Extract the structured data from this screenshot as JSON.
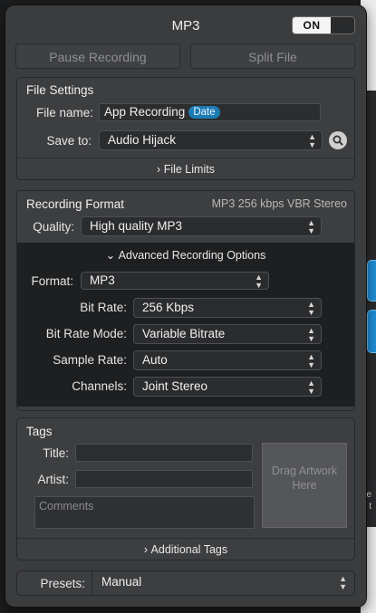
{
  "window": {
    "title": "MP3",
    "toggle_label": "ON"
  },
  "toolbar": {
    "pause_label": "Pause Recording",
    "split_label": "Split File"
  },
  "file_settings": {
    "title": "File Settings",
    "file_name_label": "File name:",
    "file_name_value": "App Recording",
    "date_token": "Date",
    "save_to_label": "Save to:",
    "save_to_value": "Audio Hijack",
    "limits_label": "File Limits"
  },
  "recording_format": {
    "title": "Recording Format",
    "summary": "MP3 256 kbps VBR Stereo",
    "quality_label": "Quality:",
    "quality_value": "High quality MP3",
    "advanced_label": "Advanced Recording Options",
    "format_label": "Format:",
    "format_value": "MP3",
    "bit_rate_label": "Bit Rate:",
    "bit_rate_value": "256 Kbps",
    "bit_rate_mode_label": "Bit Rate Mode:",
    "bit_rate_mode_value": "Variable Bitrate",
    "sample_rate_label": "Sample Rate:",
    "sample_rate_value": "Auto",
    "channels_label": "Channels:",
    "channels_value": "Joint Stereo"
  },
  "tags": {
    "title": "Tags",
    "title_label": "Title:",
    "title_value": "",
    "artist_label": "Artist:",
    "artist_value": "",
    "comments_placeholder": "Comments",
    "artwork_text": "Drag Artwork Here",
    "additional_label": "Additional Tags"
  },
  "presets": {
    "label": "Presets:",
    "value": "Manual"
  },
  "background_window": {
    "snippet_line1": "pe",
    "snippet_line2": "ri t"
  },
  "colors": {
    "panel": "#3b3c3e",
    "accent": "#1d7bb3",
    "advanced_bg": "#1e1f21"
  }
}
